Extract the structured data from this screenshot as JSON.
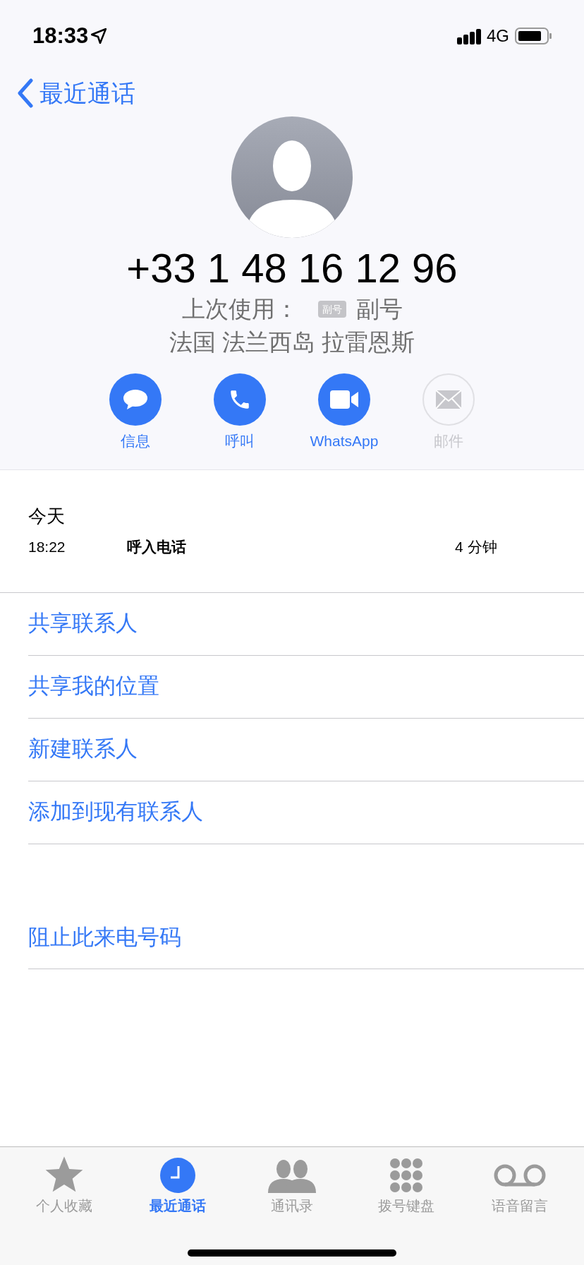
{
  "status_bar": {
    "time": "18:33",
    "network": "4G"
  },
  "nav": {
    "back_label": "最近通话"
  },
  "contact": {
    "number": "+33 1 48 16 12 96",
    "last_used_label": "上次使用：",
    "line_badge": "副号",
    "line_name": "副号",
    "location": "法国 法兰西岛 拉雷恩斯"
  },
  "actions": [
    {
      "kind": "message",
      "label": "信息",
      "disabled": false
    },
    {
      "kind": "call",
      "label": "呼叫",
      "disabled": false
    },
    {
      "kind": "video",
      "label": "WhatsApp",
      "disabled": false
    },
    {
      "kind": "mail",
      "label": "邮件",
      "disabled": true
    }
  ],
  "history": {
    "day": "今天",
    "calls": [
      {
        "time": "18:22",
        "type": "呼入电话",
        "duration": "4 分钟"
      }
    ]
  },
  "options": [
    "共享联系人",
    "共享我的位置",
    "新建联系人",
    "添加到现有联系人"
  ],
  "block_option": "阻止此来电号码",
  "tabs": [
    {
      "kind": "favorites",
      "label": "个人收藏",
      "selected": false
    },
    {
      "kind": "recents",
      "label": "最近通话",
      "selected": true
    },
    {
      "kind": "contacts",
      "label": "通讯录",
      "selected": false
    },
    {
      "kind": "keypad",
      "label": "拨号键盘",
      "selected": false
    },
    {
      "kind": "voicemail",
      "label": "语音留言",
      "selected": false
    }
  ]
}
